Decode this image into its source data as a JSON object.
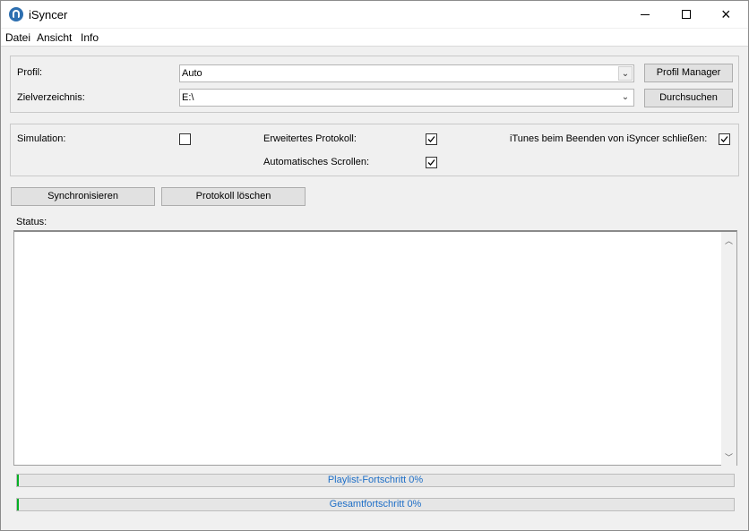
{
  "window": {
    "title": "iSyncer",
    "close_glyph": "×"
  },
  "menu": [
    "Datei",
    "Ansicht",
    "Info"
  ],
  "profile": {
    "label": "Profil:",
    "value": "Auto",
    "button": "Profil Manager"
  },
  "target": {
    "label": "Zielverzeichnis:",
    "value": "E:\\",
    "button": "Durchsuchen"
  },
  "options": {
    "simulation": {
      "label": "Simulation:",
      "checked": false
    },
    "extended_log": {
      "label": "Erweitertes Protokoll:",
      "checked": true
    },
    "auto_scroll": {
      "label": "Automatisches Scrollen:",
      "checked": true
    },
    "close_itunes": {
      "label": "iTunes beim Beenden von iSyncer schließen:",
      "checked": true
    }
  },
  "actions": {
    "sync": "Synchronisieren",
    "clear_log": "Protokoll löschen"
  },
  "status": {
    "label": "Status:"
  },
  "progress": {
    "playlist": {
      "text": "Playlist-Fortschritt 0%",
      "value": 0
    },
    "total": {
      "text": "Gesamtfortschritt 0%",
      "value": 0
    }
  },
  "icons": {
    "app": "isyncer-app-icon",
    "combo_arrow": "chevron-down-icon",
    "scroll_up": "scroll-up-icon",
    "scroll_down": "scroll-down-icon",
    "check": "checkmark-icon"
  },
  "colors": {
    "progress_text": "#1f6fc7",
    "progress_fill": "#06b025"
  }
}
